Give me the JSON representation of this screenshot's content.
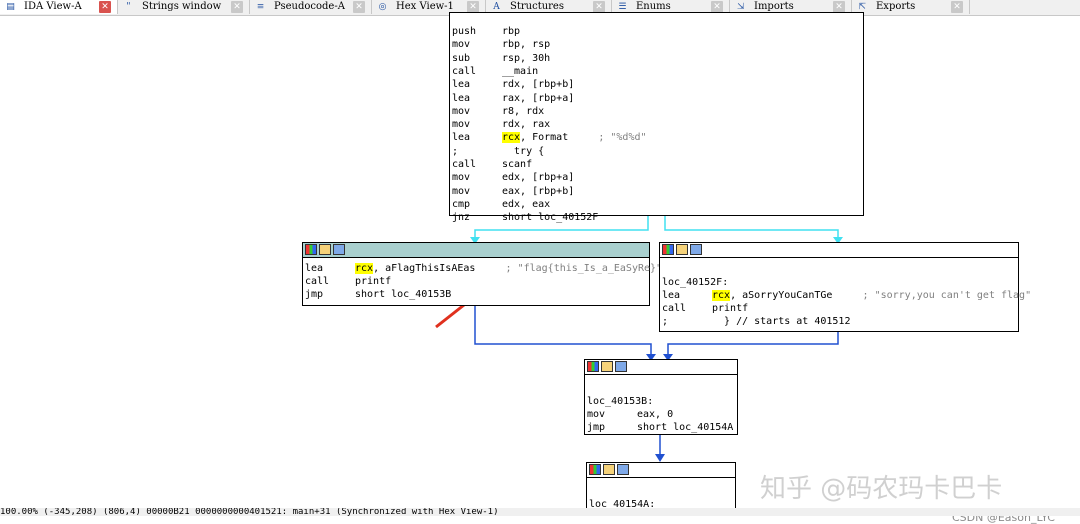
{
  "tabs": [
    {
      "label": "IDA View-A",
      "icon": "document-icon",
      "active": true
    },
    {
      "label": "Strings window",
      "icon": "strings-icon",
      "active": false
    },
    {
      "label": "Pseudocode-A",
      "icon": "pseudocode-icon",
      "active": false
    },
    {
      "label": "Hex View-1",
      "icon": "hex-icon",
      "active": false
    },
    {
      "label": "Structures",
      "icon": "structures-icon",
      "active": false
    },
    {
      "label": "Enums",
      "icon": "enums-icon",
      "active": false
    },
    {
      "label": "Imports",
      "icon": "imports-icon",
      "active": false
    },
    {
      "label": "Exports",
      "icon": "exports-icon",
      "active": false
    }
  ],
  "blocks": {
    "main": {
      "lines": [
        {
          "mn": "push",
          "op": "rbp"
        },
        {
          "mn": "mov",
          "op": "rbp, rsp"
        },
        {
          "mn": "sub",
          "op": "rsp, 30h"
        },
        {
          "mn": "call",
          "op": "__main"
        },
        {
          "mn": "lea",
          "op": "rdx, [rbp+b]"
        },
        {
          "mn": "lea",
          "op": "rax, [rbp+a]"
        },
        {
          "mn": "mov",
          "op": "r8, rdx"
        },
        {
          "mn": "mov",
          "op": "rdx, rax"
        },
        {
          "mn": "lea",
          "op_hl": "rcx",
          "op_rest": ", Format",
          "comment": "; \"%d%d\""
        },
        {
          "mn": ";",
          "op": "  try {"
        },
        {
          "mn": "call",
          "op": "scanf"
        },
        {
          "mn": "mov",
          "op": "edx, [rbp+a]"
        },
        {
          "mn": "mov",
          "op": "eax, [rbp+b]"
        },
        {
          "mn": "cmp",
          "op": "edx, eax"
        },
        {
          "mn": "jnz",
          "op": "short loc_40152F"
        }
      ]
    },
    "flag": {
      "lines": [
        {
          "mn": "lea",
          "op_hl": "rcx",
          "op_rest": ", aFlagThisIsAEas",
          "comment": "; \"flag{this_Is_a_EaSyRe}\""
        },
        {
          "mn": "call",
          "op": "printf"
        },
        {
          "mn": "jmp",
          "op": "short loc_40153B"
        }
      ]
    },
    "sorry": {
      "label": "loc_40152F:",
      "lines": [
        {
          "mn": "lea",
          "op_hl": "rcx",
          "op_rest": ", aSorryYouCanTGe",
          "comment": "; \"sorry,you can't get flag\""
        },
        {
          "mn": "call",
          "op": "printf"
        },
        {
          "mn": ";",
          "op": "  } // starts at 401512"
        }
      ]
    },
    "loc53b": {
      "label": "loc_40153B:",
      "lines": [
        {
          "mn": "mov",
          "op": "eax, 0"
        },
        {
          "mn": "jmp",
          "op": "short loc_40154A"
        }
      ]
    },
    "loc54a": {
      "label": "loc_40154A:"
    }
  },
  "status_text": "100.00% (-345,208) (806,4) 00000B21 0000000000401521: main+31 (Synchronized with Hex View-1)",
  "watermark_main": "知乎 @码农玛卡巴卡",
  "watermark_csdn": "CSDN @Eason_LYC",
  "colors": {
    "true_edge": "#40e0f0",
    "flow_edge": "#2050d0",
    "arrow": "#e0301e",
    "highlight": "#ffff00",
    "selected_header": "#a9d0cf"
  }
}
